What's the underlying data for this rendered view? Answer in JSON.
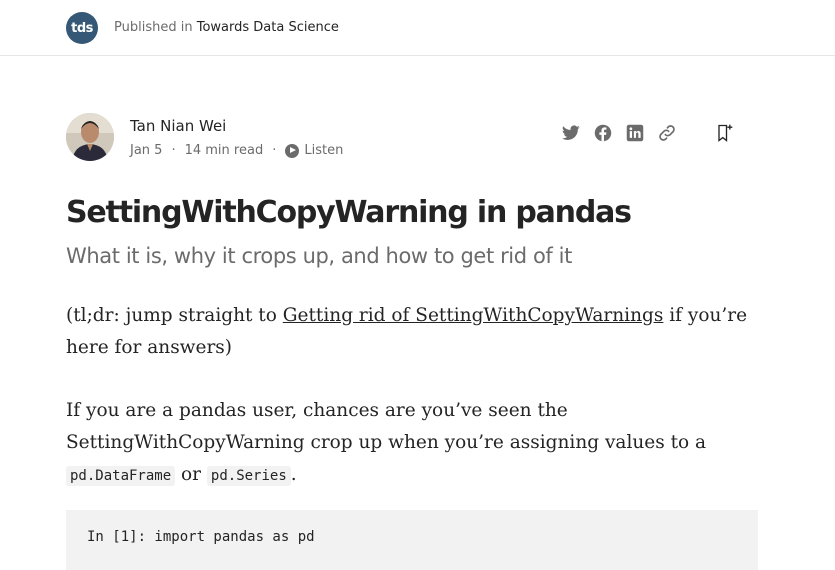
{
  "header": {
    "pub_logo_text": "tds",
    "published_in": "Published in",
    "publication": "Towards Data Science"
  },
  "author": {
    "name": "Tan Nian Wei",
    "date": "Jan 5",
    "read_time": "14 min read",
    "listen": "Listen",
    "separator": "·"
  },
  "share": {
    "icons": [
      "twitter-icon",
      "facebook-icon",
      "linkedin-icon",
      "link-icon",
      "bookmark-add-icon"
    ]
  },
  "article": {
    "title": "SettingWithCopyWarning in pandas",
    "subtitle": "What it is, why it crops up, and how to get rid of it",
    "p1_pre": "(tl;dr: jump straight to ",
    "p1_link": "Getting rid of SettingWithCopyWarnings",
    "p1_post": " if you’re here for answers)",
    "p2_pre": "If you are a pandas user, chances are you’ve seen the SettingWithCopyWarning crop up when you’re assigning values to a ",
    "p2_code1": "pd.DataFrame",
    "p2_mid": " or ",
    "p2_code2": "pd.Series",
    "p2_post": ".",
    "code_line": "In [1]: import pandas as pd"
  }
}
